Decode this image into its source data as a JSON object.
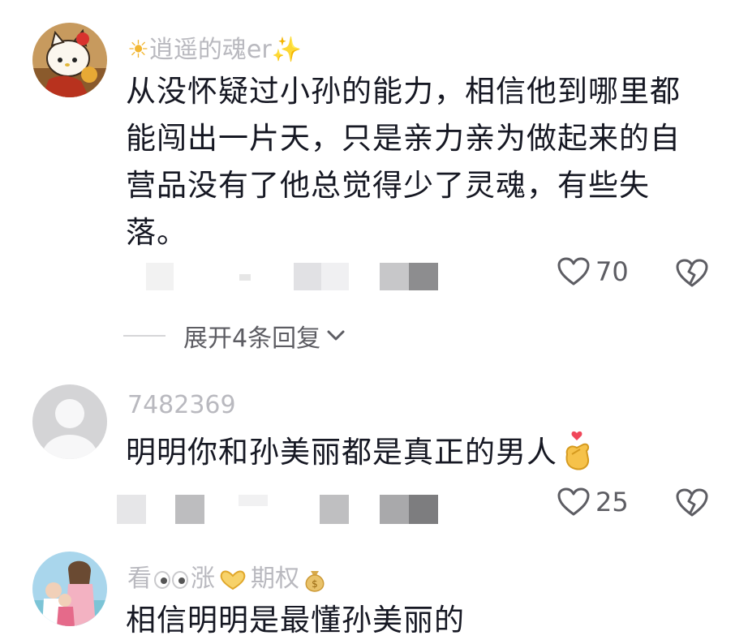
{
  "comments": [
    {
      "username": "逍遥的魂er",
      "username_prefix_emoji": "☀",
      "username_suffix_emoji": "✨",
      "text": "从没怀疑过小孙的能力，相信他到哪里都能闯出一片天，只是亲力亲为做起来的自营品没有了他总觉得少了灵魂，有些失落。",
      "likes": "70",
      "avatar": "hello-kitty-avatar"
    },
    {
      "username": "7482369",
      "text": "明明你和孙美丽都是真正的男人",
      "text_emoji": "finger-heart-emoji",
      "likes": "25",
      "avatar": "default-avatar"
    },
    {
      "username_parts": [
        "看",
        "涨",
        "期权"
      ],
      "text": "相信明明是最懂孙美丽的",
      "avatar": "family-photo-avatar"
    }
  ],
  "replies": {
    "label": "展开4条回复"
  },
  "colors": {
    "text": "#161823",
    "username": "#b9b9bf",
    "meta": "#5d5d63"
  }
}
